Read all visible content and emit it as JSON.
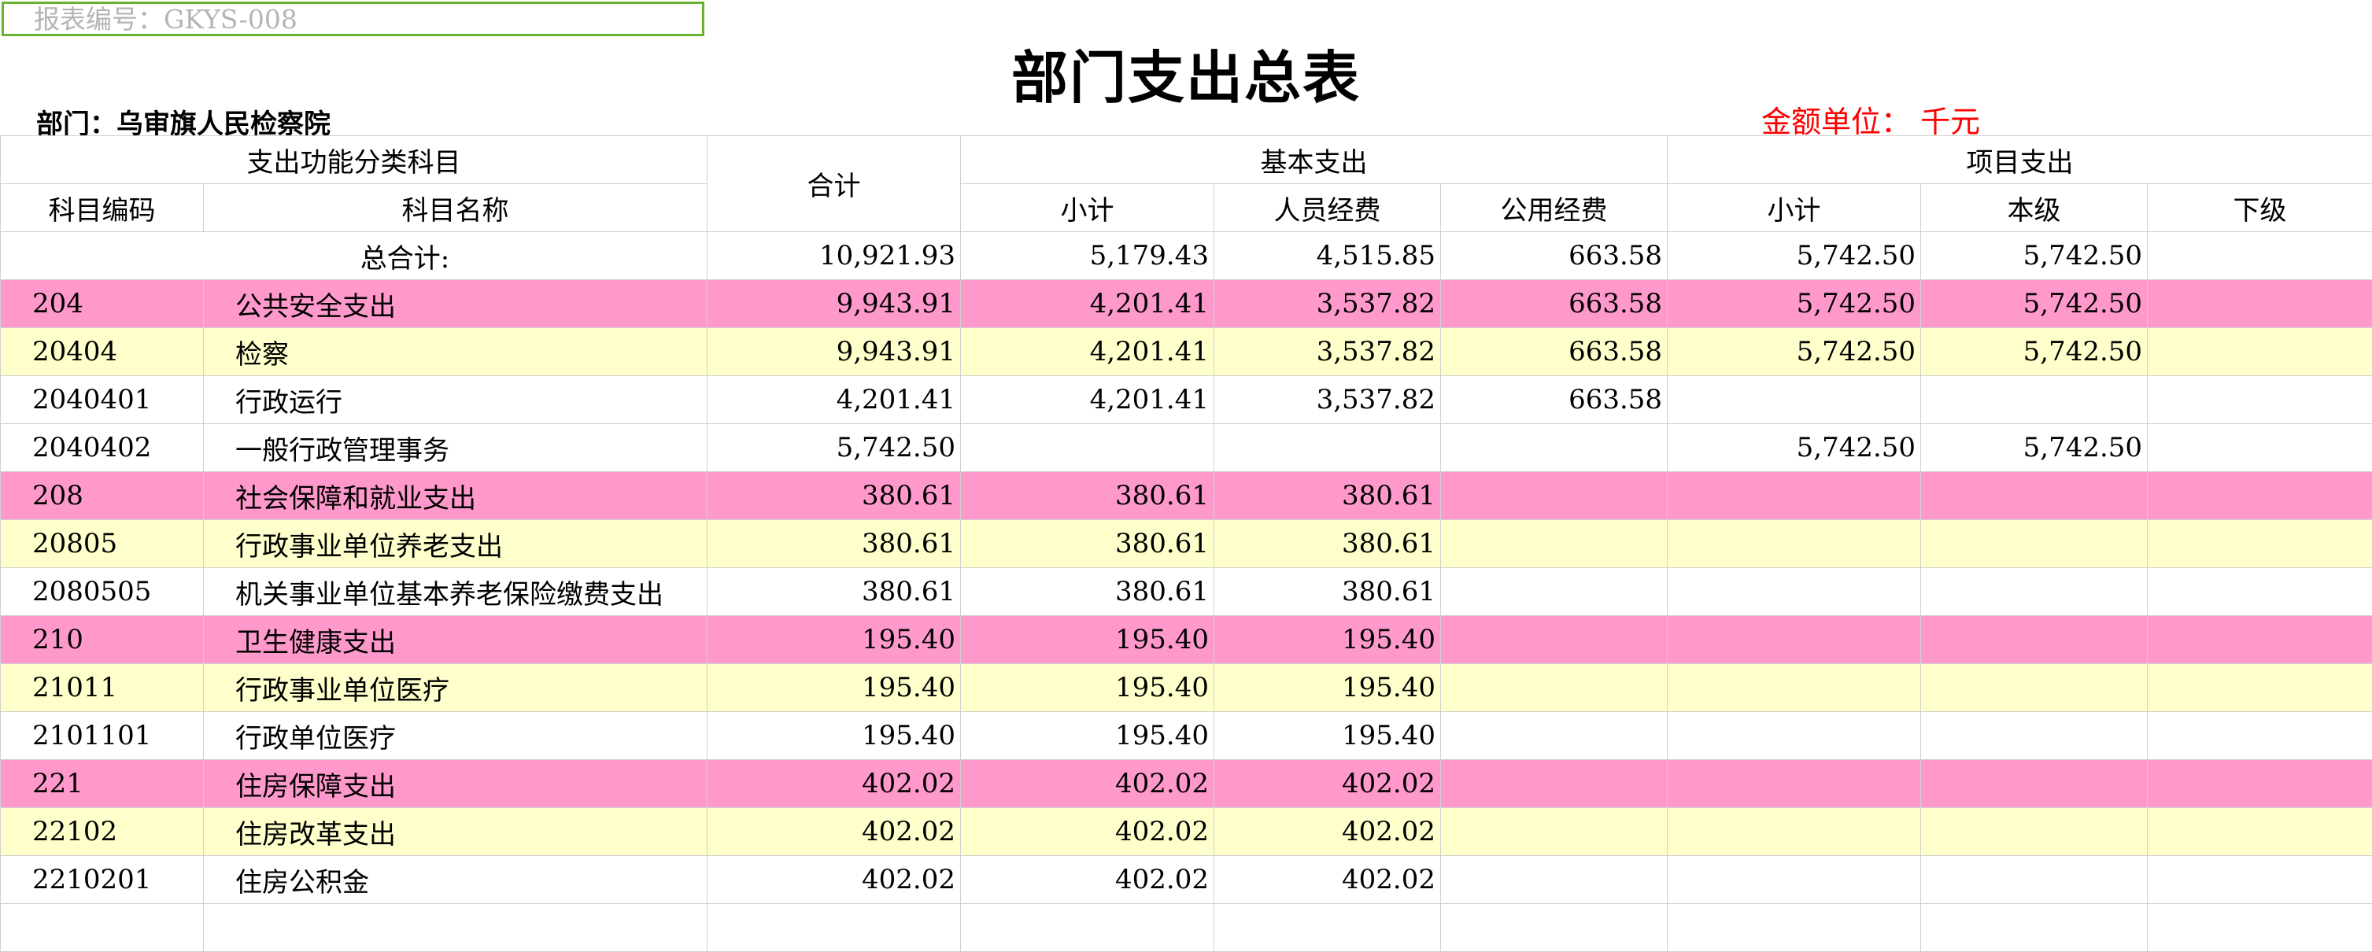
{
  "report_no": "报表编号：GKYS-008",
  "title": "部门支出总表",
  "dept": "部门：乌审旗人民检察院",
  "unit": "金额单位： 千元",
  "header": {
    "func_cat": "支出功能分类科目",
    "total": "合计",
    "basic": "基本支出",
    "project": "项目支出",
    "code": "科目编码",
    "name": "科目名称",
    "basic_subtotal": "小计",
    "personnel": "人员经费",
    "public": "公用经费",
    "proj_subtotal": "小计",
    "own_level": "本级",
    "lower_level": "下级"
  },
  "total_row": {
    "label": "总合计:",
    "total": "10,921.93",
    "basic_subtotal": "5,179.43",
    "personnel": "4,515.85",
    "public": "663.58",
    "proj_subtotal": "5,742.50",
    "own_level": "5,742.50",
    "lower_level": ""
  },
  "rows": [
    {
      "level": 1,
      "code": "204",
      "name": "公共安全支出",
      "total": "9,943.91",
      "basic_subtotal": "4,201.41",
      "personnel": "3,537.82",
      "public": "663.58",
      "proj_subtotal": "5,742.50",
      "own_level": "5,742.50",
      "lower_level": ""
    },
    {
      "level": 2,
      "code": "20404",
      "name": "检察",
      "total": "9,943.91",
      "basic_subtotal": "4,201.41",
      "personnel": "3,537.82",
      "public": "663.58",
      "proj_subtotal": "5,742.50",
      "own_level": "5,742.50",
      "lower_level": ""
    },
    {
      "level": 3,
      "code": "2040401",
      "name": "行政运行",
      "total": "4,201.41",
      "basic_subtotal": "4,201.41",
      "personnel": "3,537.82",
      "public": "663.58",
      "proj_subtotal": "",
      "own_level": "",
      "lower_level": ""
    },
    {
      "level": 3,
      "code": "2040402",
      "name": "一般行政管理事务",
      "total": "5,742.50",
      "basic_subtotal": "",
      "personnel": "",
      "public": "",
      "proj_subtotal": "5,742.50",
      "own_level": "5,742.50",
      "lower_level": ""
    },
    {
      "level": 1,
      "code": "208",
      "name": "社会保障和就业支出",
      "total": "380.61",
      "basic_subtotal": "380.61",
      "personnel": "380.61",
      "public": "",
      "proj_subtotal": "",
      "own_level": "",
      "lower_level": ""
    },
    {
      "level": 2,
      "code": "20805",
      "name": "行政事业单位养老支出",
      "total": "380.61",
      "basic_subtotal": "380.61",
      "personnel": "380.61",
      "public": "",
      "proj_subtotal": "",
      "own_level": "",
      "lower_level": ""
    },
    {
      "level": 3,
      "code": "2080505",
      "name": "机关事业单位基本养老保险缴费支出",
      "total": "380.61",
      "basic_subtotal": "380.61",
      "personnel": "380.61",
      "public": "",
      "proj_subtotal": "",
      "own_level": "",
      "lower_level": ""
    },
    {
      "level": 1,
      "code": "210",
      "name": "卫生健康支出",
      "total": "195.40",
      "basic_subtotal": "195.40",
      "personnel": "195.40",
      "public": "",
      "proj_subtotal": "",
      "own_level": "",
      "lower_level": ""
    },
    {
      "level": 2,
      "code": "21011",
      "name": "行政事业单位医疗",
      "total": "195.40",
      "basic_subtotal": "195.40",
      "personnel": "195.40",
      "public": "",
      "proj_subtotal": "",
      "own_level": "",
      "lower_level": ""
    },
    {
      "level": 3,
      "code": "2101101",
      "name": "行政单位医疗",
      "total": "195.40",
      "basic_subtotal": "195.40",
      "personnel": "195.40",
      "public": "",
      "proj_subtotal": "",
      "own_level": "",
      "lower_level": ""
    },
    {
      "level": 1,
      "code": "221",
      "name": "住房保障支出",
      "total": "402.02",
      "basic_subtotal": "402.02",
      "personnel": "402.02",
      "public": "",
      "proj_subtotal": "",
      "own_level": "",
      "lower_level": ""
    },
    {
      "level": 2,
      "code": "22102",
      "name": "住房改革支出",
      "total": "402.02",
      "basic_subtotal": "402.02",
      "personnel": "402.02",
      "public": "",
      "proj_subtotal": "",
      "own_level": "",
      "lower_level": ""
    },
    {
      "level": 3,
      "code": "2210201",
      "name": "住房公积金",
      "total": "402.02",
      "basic_subtotal": "402.02",
      "personnel": "402.02",
      "public": "",
      "proj_subtotal": "",
      "own_level": "",
      "lower_level": ""
    }
  ],
  "colors": {
    "level1_bg": "#ff99cc",
    "level2_bg": "#ffffcc",
    "unit_text": "#ff0000",
    "report_no_border": "#67b22e"
  }
}
